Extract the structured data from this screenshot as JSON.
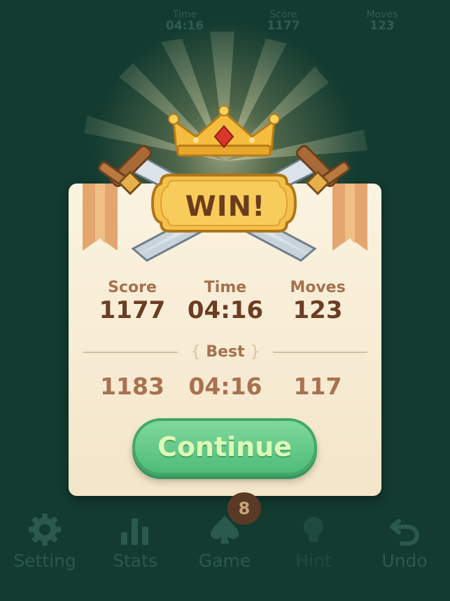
{
  "top_stats": [
    {
      "label": "Time",
      "value": "04:16"
    },
    {
      "label": "Score",
      "value": "1177"
    },
    {
      "label": "Moves",
      "value": "123"
    }
  ],
  "banner": {
    "title": "WIN!"
  },
  "stats": [
    {
      "label": "Score",
      "value": "1177",
      "best": "1183"
    },
    {
      "label": "Time",
      "value": "04:16",
      "best": "04:16"
    },
    {
      "label": "Moves",
      "value": "123",
      "best": "117"
    }
  ],
  "best_label": "Best",
  "continue_label": "Continue",
  "toolbar": [
    {
      "label": "Setting",
      "icon": "gear-icon"
    },
    {
      "label": "Stats",
      "icon": "bar-chart-icon"
    },
    {
      "label": "Game",
      "icon": "spade-icon",
      "badge": "8"
    },
    {
      "label": "Hint",
      "icon": "lightbulb-icon"
    },
    {
      "label": "Undo",
      "icon": "undo-icon"
    }
  ],
  "colors": {
    "background": "#133b30",
    "card": "#f7ecd6",
    "continue_button": "#5cc584",
    "crown": "#f2b93a",
    "text_dark": "#6b3d24"
  }
}
